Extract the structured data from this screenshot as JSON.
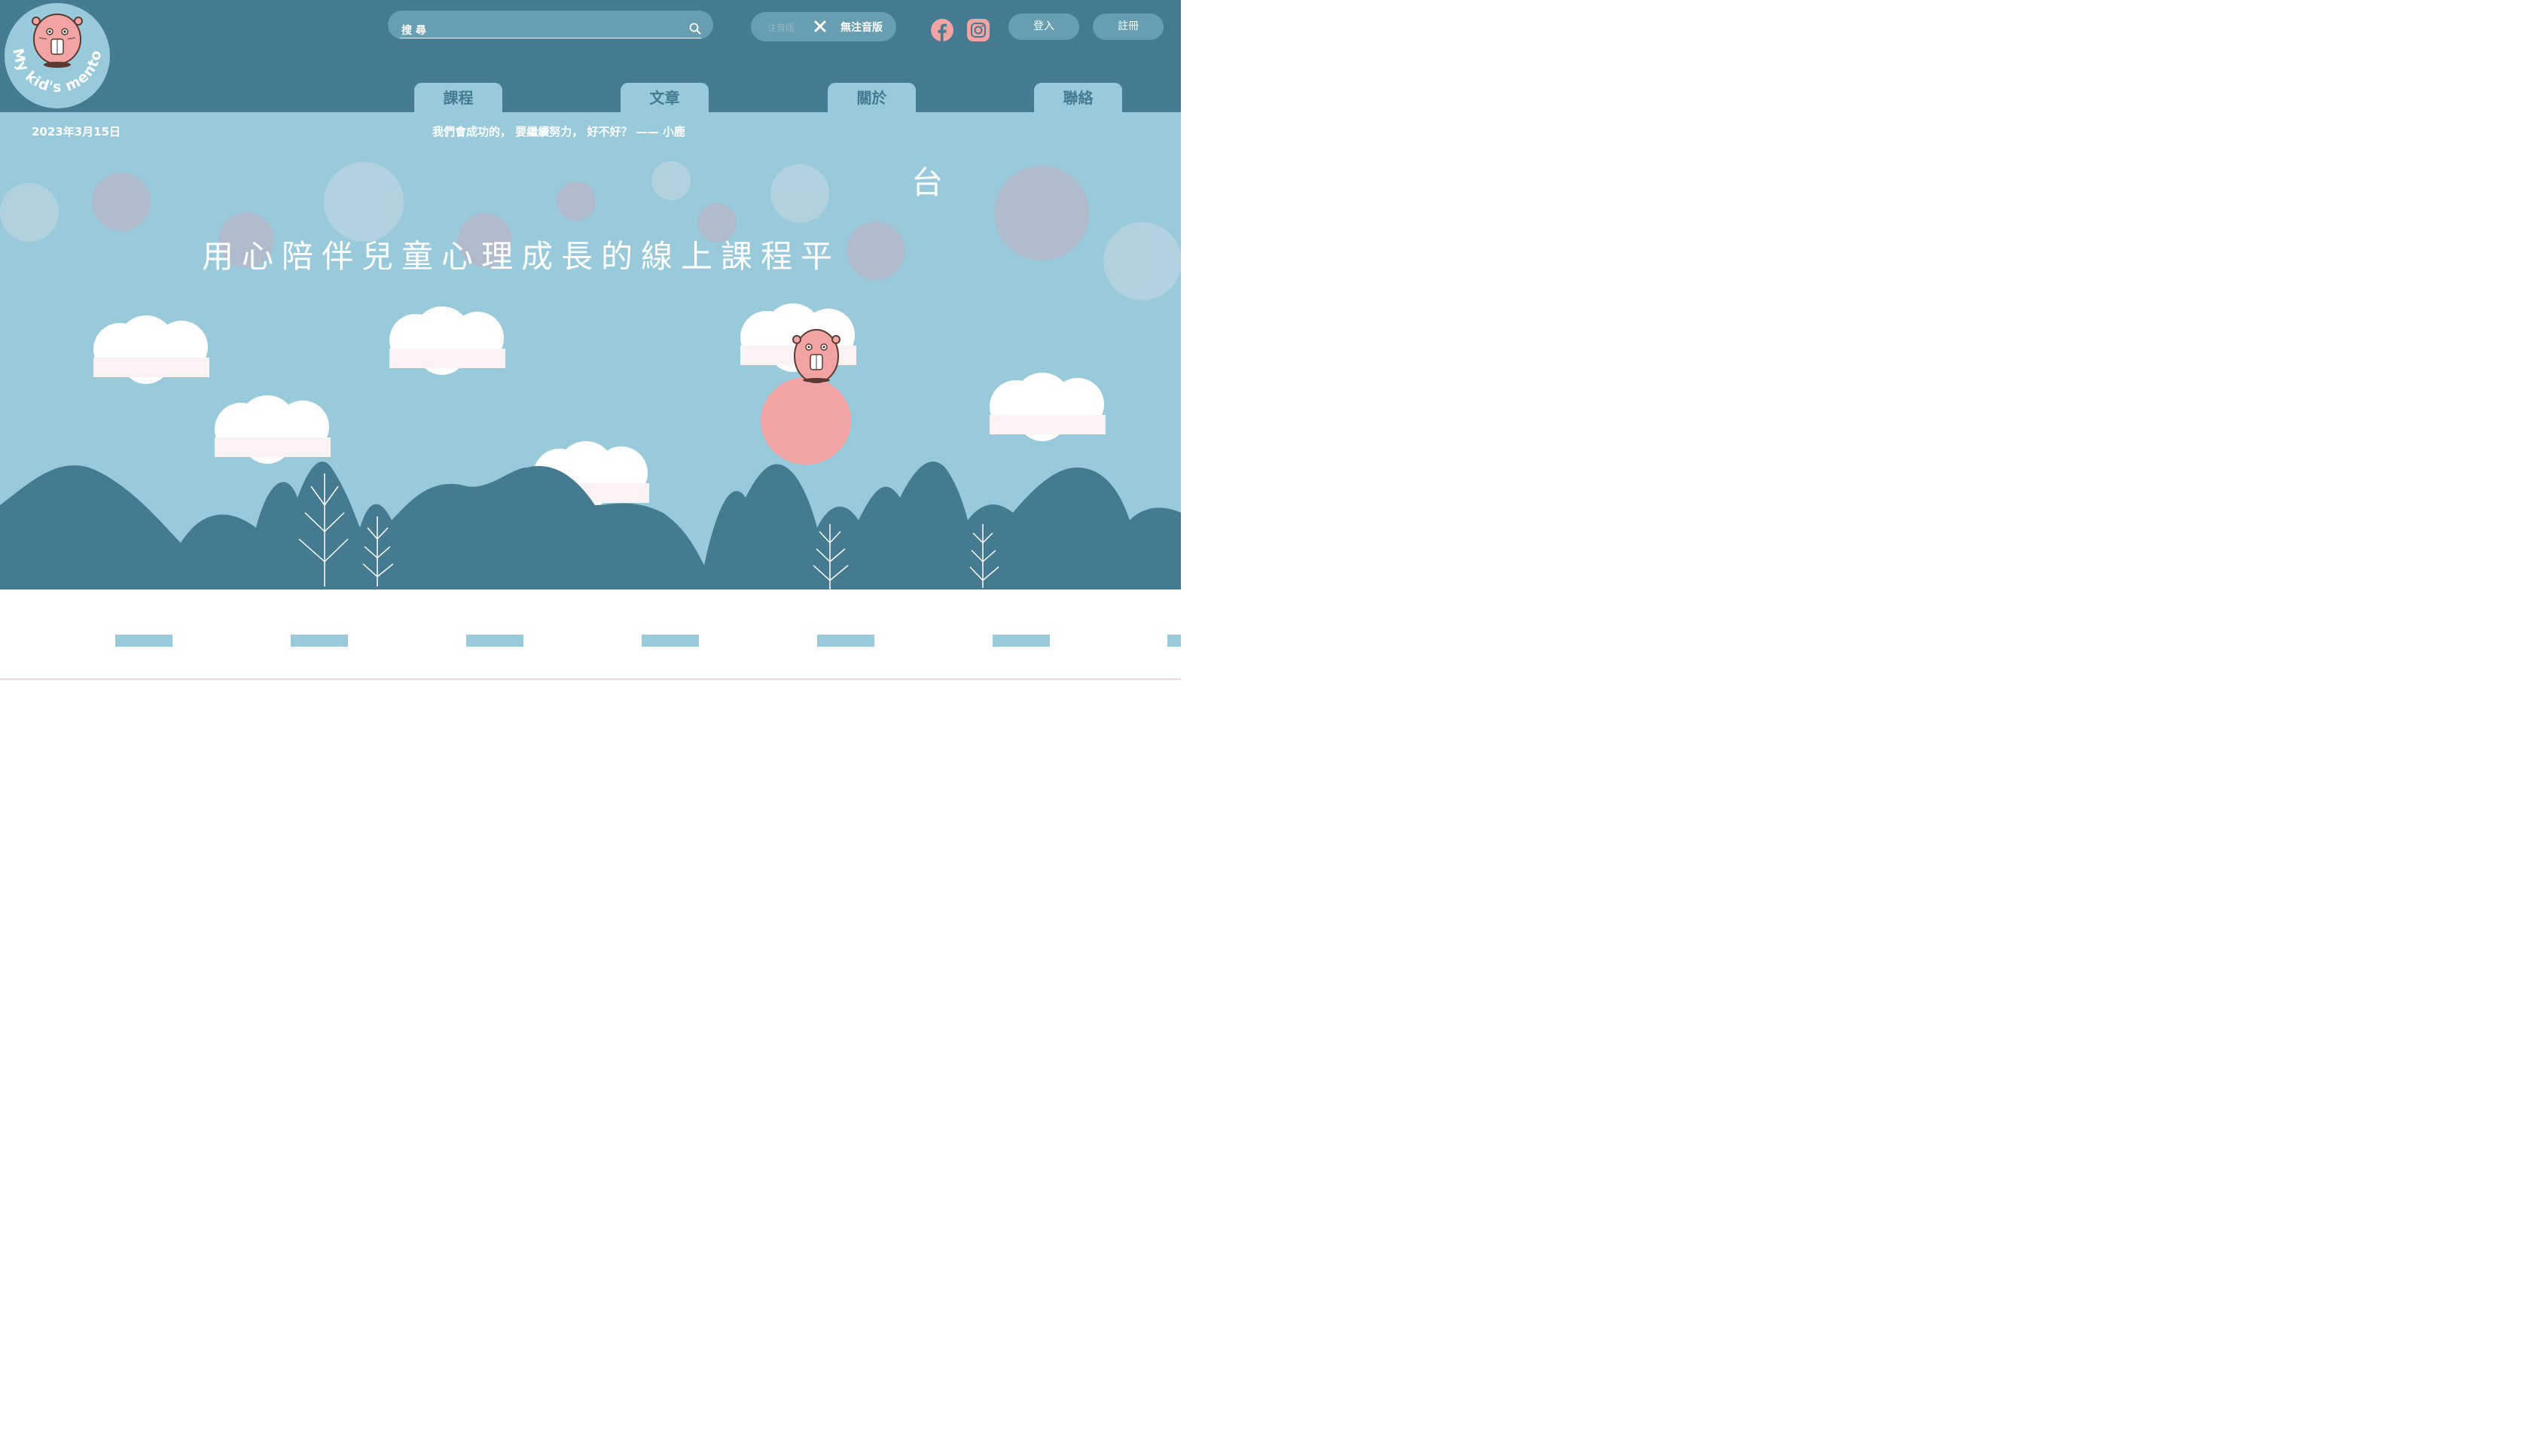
{
  "logo": {
    "text": "My kid's mentor"
  },
  "search": {
    "placeholder": "搜 尋"
  },
  "toggle": {
    "zhuyin_label": "注音版",
    "no_zhuyin_label": "無注音版"
  },
  "auth": {
    "login_label": "登入",
    "register_label": "註冊"
  },
  "nav": {
    "tabs": [
      {
        "label": "課程"
      },
      {
        "label": "文章"
      },
      {
        "label": "關於"
      },
      {
        "label": "聯絡"
      }
    ]
  },
  "subbar": {
    "date": "2023年3月15日",
    "quote": "我們會成功的， 要繼續努力， 好不好？ —— 小鹿"
  },
  "hero": {
    "headline": "用心陪伴兒童心理成長的線上課程平",
    "headline_tail": "台"
  },
  "colors": {
    "header": "#447b90",
    "sky": "#98cadc",
    "hills": "#447b90",
    "ball": "#f2a4a4",
    "pill": "#689eb1"
  }
}
